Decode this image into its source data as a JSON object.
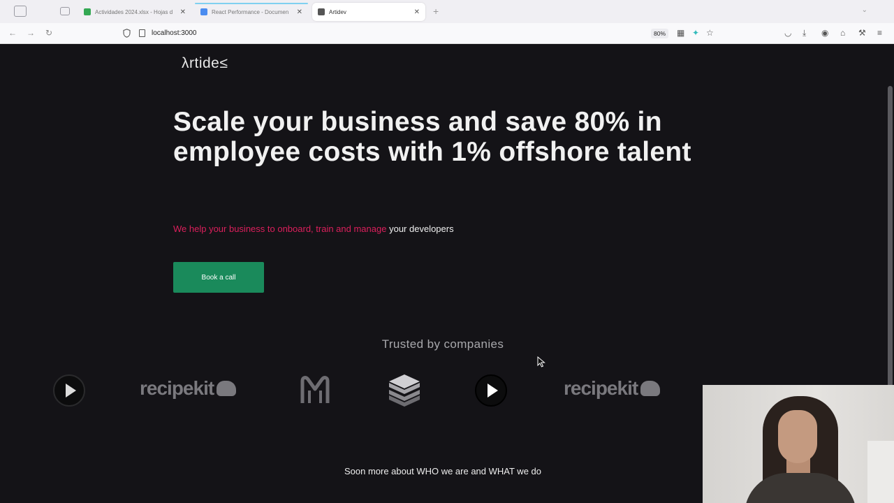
{
  "browser": {
    "tabs": [
      {
        "label": "Actividades 2024.xlsx - Hojas d",
        "favicon_color": "#34a853",
        "active": false
      },
      {
        "label": "React Performance - Documen",
        "favicon_color": "#4a8cf0",
        "active": false
      },
      {
        "label": "Artidev",
        "favicon_color": "#555555",
        "active": true
      }
    ],
    "new_tab_icon": "+",
    "url": "localhost:3000",
    "zoom": "80%"
  },
  "page": {
    "logo_text": "λrtide≤",
    "headline": "Scale your business and save 80% in employee costs with 1% offshore talent",
    "subline_pink": "We help your business to onboard, train and manage",
    "subline_white": "your developers",
    "cta_label": "Book a call",
    "trusted_heading": "Trusted by companies",
    "logos": [
      {
        "type": "play",
        "name": "play-logo"
      },
      {
        "type": "recipekit",
        "text": "recipekit"
      },
      {
        "type": "m",
        "name": "m-logo"
      },
      {
        "type": "stack",
        "name": "stack-logo"
      },
      {
        "type": "play",
        "name": "play-logo"
      },
      {
        "type": "recipekit",
        "text": "recipekit"
      }
    ],
    "about_text": "Soon more about WHO we are and WHAT we do"
  },
  "colors": {
    "background": "#141317",
    "accent_pink": "#dc1f5c",
    "cta_green": "#1a8a5b",
    "muted": "#a8a8ac"
  }
}
